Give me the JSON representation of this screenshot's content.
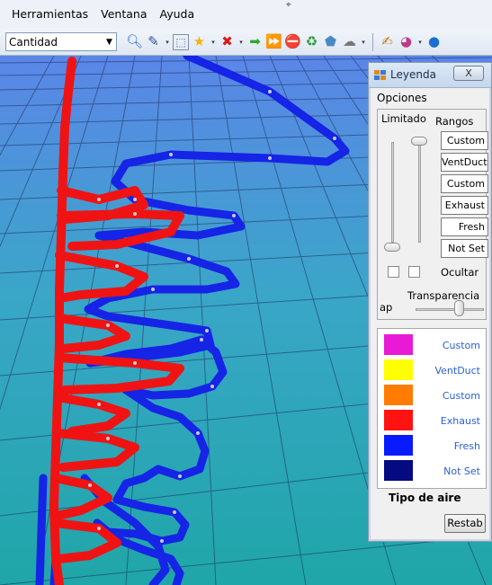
{
  "menubar": {
    "items": [
      "Herramientas",
      "Ventana",
      "Ayuda"
    ]
  },
  "toolbar": {
    "mode_combo": "Cantidad",
    "icons": [
      "zoom-icon",
      "pencil-icon",
      "select-box-icon",
      "star-icon",
      "delete-icon",
      "arrow-right-icon",
      "double-arrow-icon",
      "stop-icon",
      "recycle-icon",
      "solid-icon",
      "wire-icon",
      "notepad-icon",
      "palette-icon",
      "help-icon"
    ]
  },
  "legend": {
    "title": "Leyenda",
    "close_label": "X",
    "options_tab": "Opciones",
    "limitado_label": "Limitado",
    "rangos_label": "Rangos",
    "range_buttons": [
      "Custom",
      "VentDuct",
      "Custom",
      "Exhaust",
      "Fresh",
      "Not Set"
    ],
    "ocultar_label": "Ocultar",
    "transparencia_label": "Transparencia",
    "ap_label": "ap",
    "transparency_level": 0.66,
    "color_items": [
      {
        "color": "#e81ad6",
        "label": "Custom"
      },
      {
        "color": "#ffff00",
        "label": "VentDuct"
      },
      {
        "color": "#ff7c00",
        "label": "Custom"
      },
      {
        "color": "#ff1212",
        "label": "Exhaust"
      },
      {
        "color": "#0a1aff",
        "label": "Fresh"
      },
      {
        "color": "#040a80",
        "label": "Not Set"
      }
    ],
    "tipo_label": "Tipo de aire",
    "restab_label": "Restab"
  }
}
